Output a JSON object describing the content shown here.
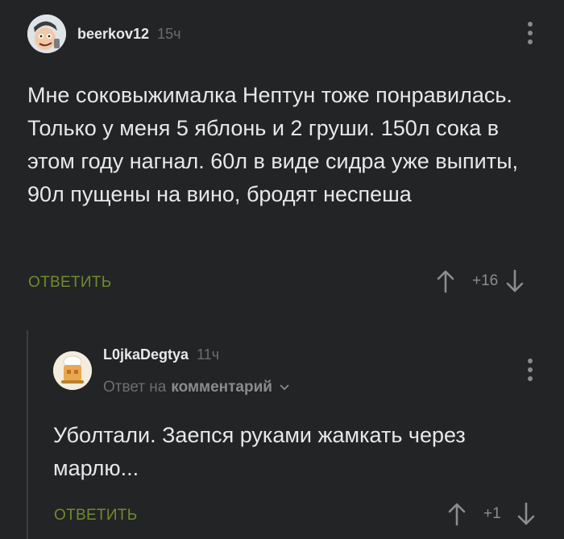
{
  "comments": [
    {
      "username": "beerkov12",
      "time": "15ч",
      "text": "Мне соковыжималка Нептун тоже понравилась. Только у меня 5 яблонь и 2 груши. 150л сока в этом году нагнал. 60л в виде сидра уже выпиты, 90л пущены на вино, бродят неспеша",
      "reply_label": "ОТВЕТИТЬ",
      "rating": "+16"
    },
    {
      "username": "L0jkaDegtya",
      "time": "11ч",
      "reply_prefix": "Ответ на",
      "reply_target": "комментарий",
      "text": "Уболтали. Заепся руками жамкать через марлю...",
      "reply_label": "ОТВЕТИТЬ",
      "rating": "+1"
    }
  ],
  "colors": {
    "background": "#232425",
    "accent_green": "#6f8b2e",
    "muted": "#6d6e70"
  }
}
